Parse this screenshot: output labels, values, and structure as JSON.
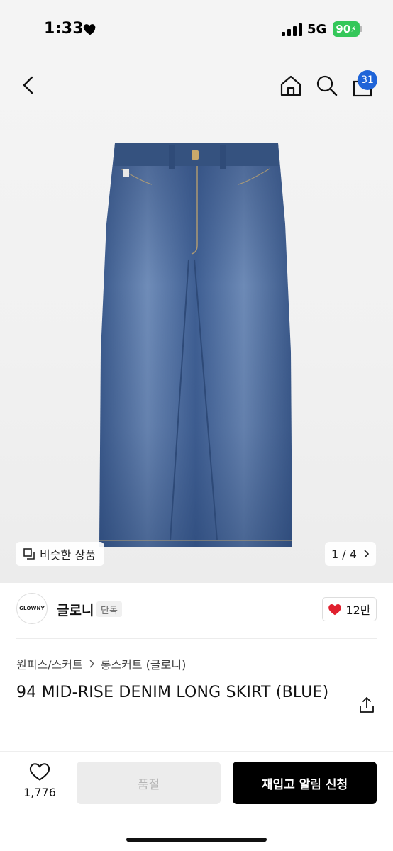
{
  "status_bar": {
    "time": "1:33",
    "network": "5G",
    "battery": "90"
  },
  "header": {
    "cart_count": "31"
  },
  "gallery": {
    "similar_label": "비슷한 상품",
    "page_indicator": "1 / 4"
  },
  "brand": {
    "logo_text": "GLOWNY",
    "name": "글로니",
    "tag": "단독",
    "likes": "12만"
  },
  "breadcrumb": [
    "원피스/스커트",
    "롱스커트 (글로니)"
  ],
  "product": {
    "title": "94 MID-RISE DENIM LONG SKIRT (BLUE)"
  },
  "actions": {
    "wish_count": "1,776",
    "soldout_label": "품절",
    "restock_label": "재입고 알림 신청"
  },
  "colors": {
    "accent": "#1f64d8",
    "like_red": "#e0202e",
    "battery_green": "#34c759",
    "cta_black": "#000000",
    "denim": "#4a6a9e"
  },
  "icons": [
    "back-icon",
    "home-icon",
    "search-icon",
    "bag-icon",
    "similar-icon",
    "chevron-right-icon",
    "heart-icon",
    "share-icon"
  ]
}
